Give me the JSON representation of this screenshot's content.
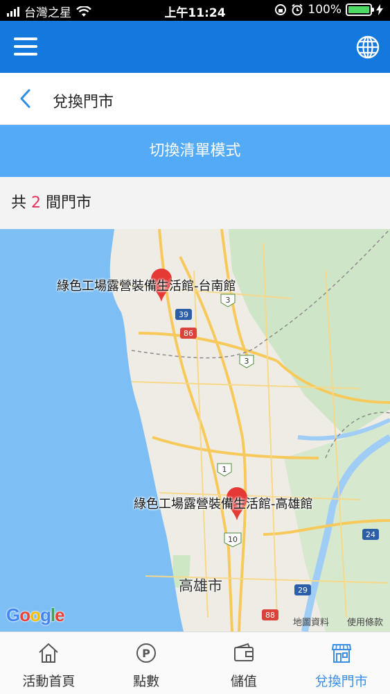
{
  "status": {
    "carrier": "台灣之星",
    "time": "上午11:24",
    "battery": "100%"
  },
  "header": {
    "page_title": "兌換門市"
  },
  "switch_mode_label": "切換清單模式",
  "store_count": {
    "prefix": "共 ",
    "count": "2",
    "suffix": " 間門市"
  },
  "map": {
    "stores": [
      {
        "name": "綠色工場露營裝備生活館-台南館"
      },
      {
        "name": "綠色工場露營裝備生活館-高雄館"
      }
    ],
    "city_label": "高雄市",
    "road_shields": [
      "3",
      "39",
      "86",
      "3",
      "1",
      "10",
      "24",
      "29",
      "88"
    ],
    "provider_logo": "Google",
    "map_data_link": "地圖資料",
    "terms_link": "使用條款"
  },
  "tabs": [
    {
      "label": "活動首頁",
      "icon": "home-icon",
      "active": false
    },
    {
      "label": "點數",
      "icon": "points-icon",
      "active": false
    },
    {
      "label": "儲值",
      "icon": "wallet-icon",
      "active": false
    },
    {
      "label": "兌換門市",
      "icon": "store-icon",
      "active": true
    }
  ],
  "colors": {
    "appbar": "#1479dc",
    "switch_bar": "#53aaf6",
    "accent": "#e8305a",
    "tab_active": "#3a8ee8",
    "pin": "#e53935"
  }
}
